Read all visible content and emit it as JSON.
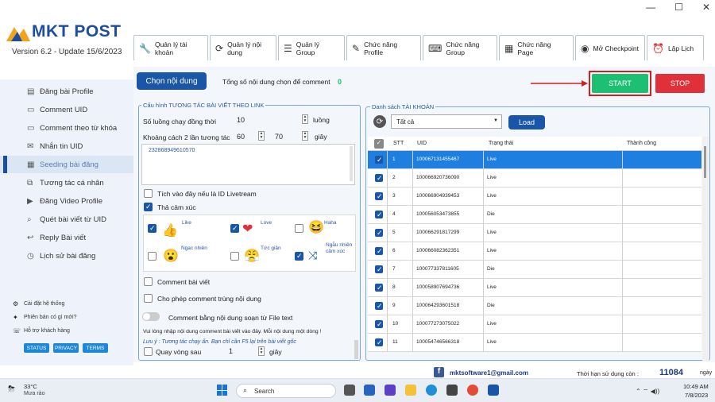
{
  "app": {
    "brand": "MKT POST",
    "version_label": "Version  6.2  - Update  15/6/2023"
  },
  "tabs": [
    {
      "icon": "wrench-icon",
      "label": "Quản lý tài khoản"
    },
    {
      "icon": "sync-icon",
      "label": "Quản lý nội dung"
    },
    {
      "icon": "list-icon",
      "label": "Quản lý Group"
    },
    {
      "icon": "pen-icon",
      "label": "Chức năng Profile"
    },
    {
      "icon": "keyboard-icon",
      "label": "Chức năng Group"
    },
    {
      "icon": "calendar-icon",
      "label": "Chức năng Page"
    },
    {
      "icon": "user-circle-icon",
      "label": "Mở Checkpoint"
    },
    {
      "icon": "alarm-icon",
      "label": "Lập Lịch"
    }
  ],
  "sidebar": {
    "items": [
      {
        "label": "Đăng bài Profile"
      },
      {
        "label": "Comment UID"
      },
      {
        "label": "Comment theo từ khóa"
      },
      {
        "label": "Nhắn tin UID"
      },
      {
        "label": "Seeding bài đăng"
      },
      {
        "label": "Tương tác cá nhân"
      },
      {
        "label": "Đăng Video Profile"
      },
      {
        "label": "Quét bài viết từ UID"
      },
      {
        "label": "Reply Bài viết"
      },
      {
        "label": "Lịch sử bài đăng"
      }
    ],
    "footer": [
      "Cài đặt hệ thống",
      "Phiên bản có gì mới?",
      "Hỗ trợ khách hàng"
    ],
    "pills": [
      "STATUS",
      "PRIVACY",
      "TERMS"
    ]
  },
  "toolbar": {
    "choose_content": "Chọn nội dung",
    "total_label": "Tổng số nội dung chọn để comment",
    "total_value": "0",
    "start": "START",
    "stop": "STOP"
  },
  "config": {
    "legend": "Cấu hình TƯƠNG TÁC BÀI VIẾT THEO LINK",
    "threads_label": "Số luồng chạy đồng thời",
    "threads_value": "10",
    "threads_unit": "luồng",
    "gap_label": "Khoảng cách 2 lần tương tác",
    "gap_min": "60",
    "gap_max": "70",
    "gap_unit": "giây",
    "links": "232868949610570",
    "livestream": "Tích vào đây nếu là ID Livetream",
    "react": "Thả cảm xúc",
    "reactions": [
      "Like",
      "Love",
      "Haha",
      "Ngạc nhiên",
      "Tức giận",
      "Ngẫu nhiên cảm xúc"
    ],
    "comment": "Comment bài viết",
    "dup": "Cho phép comment trùng nội dung",
    "file": "Comment bằng nội dung soạn từ File text",
    "note": "Vui lòng nhập nội dung comment bài viết vào đây. Mỗi nội dung một dòng !",
    "warn": "Lưu ý : Tương tác chạy ẩn. Bạn chỉ cần F5 lại trên bài viết gốc",
    "loop_label": "Quay vòng sau",
    "loop_value": "1",
    "loop_unit": "giây"
  },
  "accounts": {
    "legend": "Danh sách TÀI KHOẢN",
    "filter": "Tất cả",
    "load": "Load",
    "headers": [
      "STT",
      "UID",
      "Trạng thái",
      "Thành công"
    ],
    "rows": [
      {
        "stt": "1",
        "uid": "100067131455467",
        "status": "Live"
      },
      {
        "stt": "2",
        "uid": "100066920736090",
        "status": "Live"
      },
      {
        "stt": "3",
        "uid": "100066904939453",
        "status": "Live"
      },
      {
        "stt": "4",
        "uid": "100056053473855",
        "status": "Die"
      },
      {
        "stt": "5",
        "uid": "100066291817299",
        "status": "Live"
      },
      {
        "stt": "6",
        "uid": "100066082362351",
        "status": "Live"
      },
      {
        "stt": "7",
        "uid": "100077337811605",
        "status": "Die"
      },
      {
        "stt": "8",
        "uid": "100058907694736",
        "status": "Live"
      },
      {
        "stt": "9",
        "uid": "100064293601518",
        "status": "Die"
      },
      {
        "stt": "10",
        "uid": "100077273075022",
        "status": "Live"
      },
      {
        "stt": "11",
        "uid": "100054746566318",
        "status": "Live"
      }
    ]
  },
  "footer": {
    "email": "mktsoftware1@gmail.com",
    "expiry_label": "Thời hạn sử dụng còn :",
    "expiry_value": "11084",
    "expiry_unit": "ngày"
  },
  "taskbar": {
    "temp": "33°C",
    "weather": "Mưa rào",
    "search": "Search",
    "time": "10:49 AM",
    "date": "7/8/2023"
  },
  "colors": {
    "brand": "#1d4e9c",
    "start": "#1dbf73",
    "stop": "#e0303a",
    "selected_row": "#1e7fe0"
  }
}
